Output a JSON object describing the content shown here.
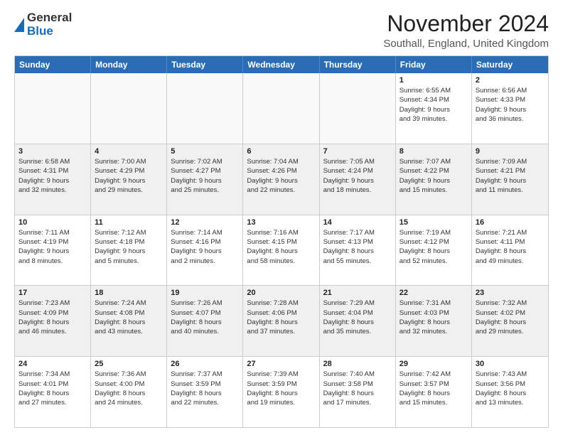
{
  "logo": {
    "line1": "General",
    "line2": "Blue"
  },
  "title": "November 2024",
  "subtitle": "Southall, England, United Kingdom",
  "headers": [
    "Sunday",
    "Monday",
    "Tuesday",
    "Wednesday",
    "Thursday",
    "Friday",
    "Saturday"
  ],
  "rows": [
    [
      {
        "day": "",
        "info": "",
        "empty": true
      },
      {
        "day": "",
        "info": "",
        "empty": true
      },
      {
        "day": "",
        "info": "",
        "empty": true
      },
      {
        "day": "",
        "info": "",
        "empty": true
      },
      {
        "day": "",
        "info": "",
        "empty": true
      },
      {
        "day": "1",
        "info": "Sunrise: 6:55 AM\nSunset: 4:34 PM\nDaylight: 9 hours\nand 39 minutes."
      },
      {
        "day": "2",
        "info": "Sunrise: 6:56 AM\nSunset: 4:33 PM\nDaylight: 9 hours\nand 36 minutes."
      }
    ],
    [
      {
        "day": "3",
        "info": "Sunrise: 6:58 AM\nSunset: 4:31 PM\nDaylight: 9 hours\nand 32 minutes.",
        "shaded": true
      },
      {
        "day": "4",
        "info": "Sunrise: 7:00 AM\nSunset: 4:29 PM\nDaylight: 9 hours\nand 29 minutes.",
        "shaded": true
      },
      {
        "day": "5",
        "info": "Sunrise: 7:02 AM\nSunset: 4:27 PM\nDaylight: 9 hours\nand 25 minutes.",
        "shaded": true
      },
      {
        "day": "6",
        "info": "Sunrise: 7:04 AM\nSunset: 4:26 PM\nDaylight: 9 hours\nand 22 minutes.",
        "shaded": true
      },
      {
        "day": "7",
        "info": "Sunrise: 7:05 AM\nSunset: 4:24 PM\nDaylight: 9 hours\nand 18 minutes.",
        "shaded": true
      },
      {
        "day": "8",
        "info": "Sunrise: 7:07 AM\nSunset: 4:22 PM\nDaylight: 9 hours\nand 15 minutes.",
        "shaded": true
      },
      {
        "day": "9",
        "info": "Sunrise: 7:09 AM\nSunset: 4:21 PM\nDaylight: 9 hours\nand 11 minutes.",
        "shaded": true
      }
    ],
    [
      {
        "day": "10",
        "info": "Sunrise: 7:11 AM\nSunset: 4:19 PM\nDaylight: 9 hours\nand 8 minutes."
      },
      {
        "day": "11",
        "info": "Sunrise: 7:12 AM\nSunset: 4:18 PM\nDaylight: 9 hours\nand 5 minutes."
      },
      {
        "day": "12",
        "info": "Sunrise: 7:14 AM\nSunset: 4:16 PM\nDaylight: 9 hours\nand 2 minutes."
      },
      {
        "day": "13",
        "info": "Sunrise: 7:16 AM\nSunset: 4:15 PM\nDaylight: 8 hours\nand 58 minutes."
      },
      {
        "day": "14",
        "info": "Sunrise: 7:17 AM\nSunset: 4:13 PM\nDaylight: 8 hours\nand 55 minutes."
      },
      {
        "day": "15",
        "info": "Sunrise: 7:19 AM\nSunset: 4:12 PM\nDaylight: 8 hours\nand 52 minutes."
      },
      {
        "day": "16",
        "info": "Sunrise: 7:21 AM\nSunset: 4:11 PM\nDaylight: 8 hours\nand 49 minutes."
      }
    ],
    [
      {
        "day": "17",
        "info": "Sunrise: 7:23 AM\nSunset: 4:09 PM\nDaylight: 8 hours\nand 46 minutes.",
        "shaded": true
      },
      {
        "day": "18",
        "info": "Sunrise: 7:24 AM\nSunset: 4:08 PM\nDaylight: 8 hours\nand 43 minutes.",
        "shaded": true
      },
      {
        "day": "19",
        "info": "Sunrise: 7:26 AM\nSunset: 4:07 PM\nDaylight: 8 hours\nand 40 minutes.",
        "shaded": true
      },
      {
        "day": "20",
        "info": "Sunrise: 7:28 AM\nSunset: 4:06 PM\nDaylight: 8 hours\nand 37 minutes.",
        "shaded": true
      },
      {
        "day": "21",
        "info": "Sunrise: 7:29 AM\nSunset: 4:04 PM\nDaylight: 8 hours\nand 35 minutes.",
        "shaded": true
      },
      {
        "day": "22",
        "info": "Sunrise: 7:31 AM\nSunset: 4:03 PM\nDaylight: 8 hours\nand 32 minutes.",
        "shaded": true
      },
      {
        "day": "23",
        "info": "Sunrise: 7:32 AM\nSunset: 4:02 PM\nDaylight: 8 hours\nand 29 minutes.",
        "shaded": true
      }
    ],
    [
      {
        "day": "24",
        "info": "Sunrise: 7:34 AM\nSunset: 4:01 PM\nDaylight: 8 hours\nand 27 minutes."
      },
      {
        "day": "25",
        "info": "Sunrise: 7:36 AM\nSunset: 4:00 PM\nDaylight: 8 hours\nand 24 minutes."
      },
      {
        "day": "26",
        "info": "Sunrise: 7:37 AM\nSunset: 3:59 PM\nDaylight: 8 hours\nand 22 minutes."
      },
      {
        "day": "27",
        "info": "Sunrise: 7:39 AM\nSunset: 3:59 PM\nDaylight: 8 hours\nand 19 minutes."
      },
      {
        "day": "28",
        "info": "Sunrise: 7:40 AM\nSunset: 3:58 PM\nDaylight: 8 hours\nand 17 minutes."
      },
      {
        "day": "29",
        "info": "Sunrise: 7:42 AM\nSunset: 3:57 PM\nDaylight: 8 hours\nand 15 minutes."
      },
      {
        "day": "30",
        "info": "Sunrise: 7:43 AM\nSunset: 3:56 PM\nDaylight: 8 hours\nand 13 minutes."
      }
    ]
  ]
}
